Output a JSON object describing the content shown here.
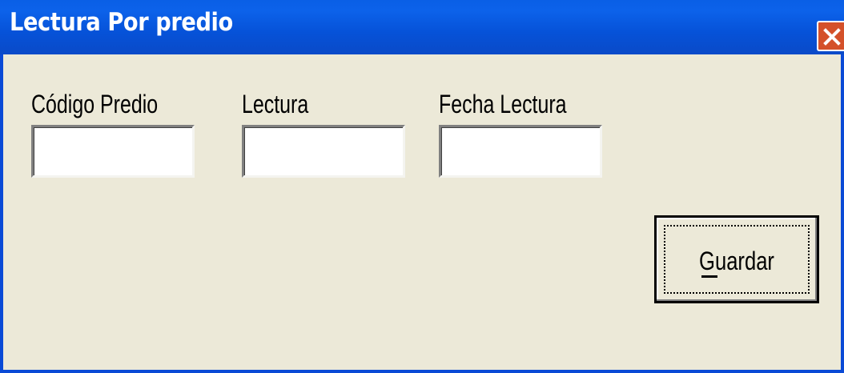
{
  "window": {
    "title": "Lectura Por predio"
  },
  "form": {
    "codigo_label": "Código Predio",
    "lectura_label": "Lectura",
    "fecha_label": "Fecha Lectura",
    "codigo_value": "",
    "lectura_value": "",
    "fecha_value": ""
  },
  "actions": {
    "save_label": "Guardar",
    "save_mnemonic": "G"
  },
  "icons": {
    "close": "close-icon"
  },
  "colors": {
    "titlebar": "#0a5fe6",
    "window_bg": "#ece9d8",
    "close_button": "#d4512a"
  }
}
